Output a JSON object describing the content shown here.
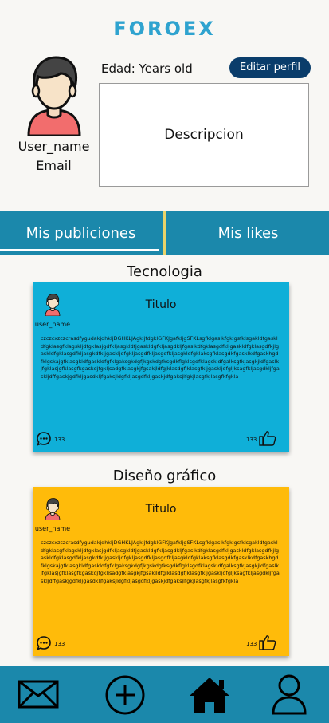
{
  "app": {
    "logo": "FOROEX"
  },
  "profile": {
    "username": "User_name",
    "email": "Email",
    "age": "Edad: Years old",
    "edit_label": "Editar perfil",
    "description": "Descripcion"
  },
  "tabs": [
    {
      "label": "Mis publiciones"
    },
    {
      "label": "Mis likes"
    }
  ],
  "posts": [
    {
      "category": "Tecnologia",
      "color": "#0fafd8",
      "username": "user_name",
      "title": "Titulo",
      "body": "czczcxzczcrasdfygudakjdhkljDGHKLJAgkljfdgklGFKJgafkljgSFKLsgfklgaslkfgklgsfklsgakldfgaskldfgklasgfklagskljdfgklasjgdfkljasgkldfjgaskldgfkljasgdkljfgaslkdfgklasgdfkljgaskldfgklasgdfkjlgaskldfgklasgdfkljasgkdfkljgaskljdfgkljasgdfkljasgdfkljasgkldfgklaksgfklasgdkfgasklkdfgaskhgdfklgskajgfklasgkldfgaskldfgfklgaksgkdgfjkgskdgfksgdkflgklsgdfklagskldfgalksgfkjasgkjldfgaslkjfgklasjgfklasgfkgaskdjfgkljsadgfklasgkjfgsakjldfgjklasdgfjklasgfkljgaskljdfgljksagfkljasgdkljfgaskljdffgaskjgdfkljgasdkljfgaksjldgfkljasgdfkljgaskjdfgaksjlfgkjlasgfkjlasgfkfgkla",
      "comments": "133",
      "likes": "133"
    },
    {
      "category": "Diseño gráfico",
      "color": "#ffbb0a",
      "username": "user_name",
      "title": "Titulo",
      "body": "czczcxzczcrasdfygudakjdhkljDGHKLJAgkljfdgklGFKJgafkljgSFKLsgfklgaslkfgklgsfklsgakldfgaskldfgklasgfklagskljdfgklasjgdfkljasgkldfjgaskldgfkljasgdkljfgaslkdfgklasgdfkljgaskldfgklasgdfkjlgaskldfgklasgdfkljasgkdfkljgaskljdfgkljasgdfkljasgdfkljasgkldfgklaksgfklasgdkfgasklkdfgaskhgdfklgskajgfklasgkldfgaskldfgfklgaksgkdgfjkgskdgfksgdkflgklsgdfklagskldfgalksgfkjasgkjldfgaslkjfgklasjgfklasgfkgaskdjfgkljsadgfklasgkjfgsakjldfgjklasdgfjklasgfkljgaskljdfgljksagfkljasgdkljfgaskljdffgaskjgdfkljgasdkljfgaksjldgfkljasgdfkljgaskjdfgaksjlfgkjlasgfkjlasgfkfgkla",
      "comments": "133",
      "likes": "133"
    }
  ],
  "bottom_nav": [
    "mail-icon",
    "add-icon",
    "home-icon",
    "profile-icon"
  ]
}
